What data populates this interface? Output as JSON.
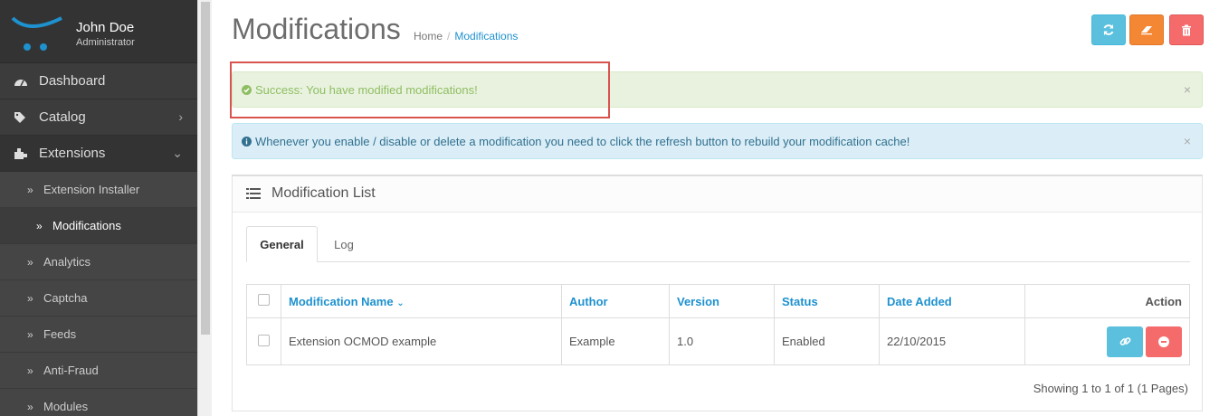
{
  "user": {
    "name": "John Doe",
    "role": "Administrator"
  },
  "nav": {
    "dashboard": "Dashboard",
    "catalog": "Catalog",
    "extensions": "Extensions",
    "sub": [
      {
        "label": "Extension Installer",
        "active": false
      },
      {
        "label": "Modifications",
        "active": true
      },
      {
        "label": "Analytics",
        "active": false
      },
      {
        "label": "Captcha",
        "active": false
      },
      {
        "label": "Feeds",
        "active": false
      },
      {
        "label": "Anti-Fraud",
        "active": false
      },
      {
        "label": "Modules",
        "active": false
      }
    ]
  },
  "header": {
    "title": "Modifications",
    "breadcrumb": {
      "home": "Home",
      "separator": "/",
      "current": "Modifications"
    }
  },
  "alerts": {
    "success": "Success: You have modified modifications!",
    "info": "Whenever you enable / disable or delete a modification you need to click the refresh button to rebuild your modification cache!",
    "close": "×"
  },
  "panel": {
    "title": "Modification List",
    "tabs": {
      "general": "General",
      "log": "Log"
    },
    "columns": {
      "name": "Modification Name",
      "author": "Author",
      "version": "Version",
      "status": "Status",
      "date": "Date Added",
      "action": "Action"
    },
    "rows": [
      {
        "name": "Extension OCMOD example",
        "author": "Example",
        "version": "1.0",
        "status": "Enabled",
        "date": "22/10/2015"
      }
    ],
    "pagination": "Showing 1 to 1 of 1 (1 Pages)"
  },
  "colors": {
    "accent": "#1e91cf",
    "info": "#5bc0de",
    "warning": "#f38733",
    "danger": "#f56b6b",
    "success_text": "#8fbe62"
  },
  "icons": {
    "sort": "chevron-down-icon"
  }
}
